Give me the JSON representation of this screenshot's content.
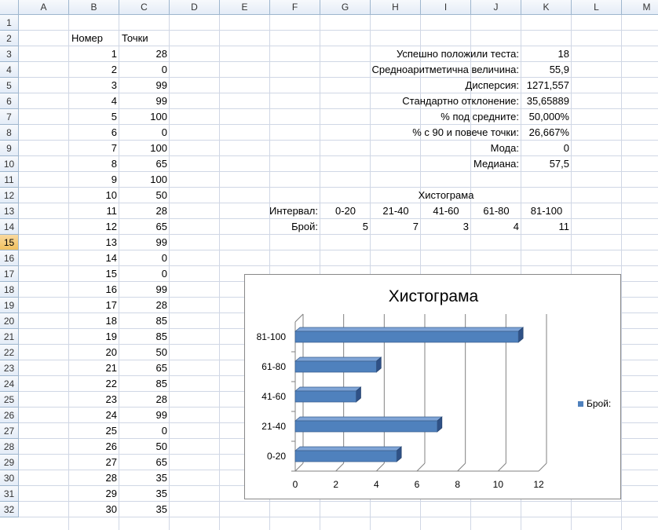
{
  "columns": [
    "A",
    "B",
    "C",
    "D",
    "E",
    "F",
    "G",
    "H",
    "I",
    "J",
    "K",
    "L",
    "M"
  ],
  "rows": [
    "1",
    "2",
    "3",
    "4",
    "5",
    "6",
    "7",
    "8",
    "9",
    "10",
    "11",
    "12",
    "13",
    "14",
    "15",
    "16",
    "17",
    "18",
    "19",
    "20",
    "21",
    "22",
    "23",
    "24",
    "25",
    "26",
    "27",
    "28",
    "29",
    "30",
    "31",
    "32"
  ],
  "selected_row": "15",
  "table": {
    "header_num": "Номер",
    "header_points": "Точки",
    "rows": [
      [
        "1",
        "28"
      ],
      [
        "2",
        "0"
      ],
      [
        "3",
        "99"
      ],
      [
        "4",
        "99"
      ],
      [
        "5",
        "100"
      ],
      [
        "6",
        "0"
      ],
      [
        "7",
        "100"
      ],
      [
        "8",
        "65"
      ],
      [
        "9",
        "100"
      ],
      [
        "10",
        "50"
      ],
      [
        "11",
        "28"
      ],
      [
        "12",
        "65"
      ],
      [
        "13",
        "99"
      ],
      [
        "14",
        "0"
      ],
      [
        "15",
        "0"
      ],
      [
        "16",
        "99"
      ],
      [
        "17",
        "28"
      ],
      [
        "18",
        "85"
      ],
      [
        "19",
        "85"
      ],
      [
        "20",
        "50"
      ],
      [
        "21",
        "65"
      ],
      [
        "22",
        "85"
      ],
      [
        "23",
        "28"
      ],
      [
        "24",
        "99"
      ],
      [
        "25",
        "0"
      ],
      [
        "26",
        "50"
      ],
      [
        "27",
        "65"
      ],
      [
        "28",
        "35"
      ],
      [
        "29",
        "35"
      ],
      [
        "30",
        "35"
      ]
    ]
  },
  "stats": [
    {
      "label": "Успешно положили теста:",
      "value": "18"
    },
    {
      "label": "Средноаритметична величина:",
      "value": "55,9"
    },
    {
      "label": "Дисперсия:",
      "value": "1271,557"
    },
    {
      "label": "Стандартно отклонение:",
      "value": "35,65889"
    },
    {
      "label": "% под средните:",
      "value": "50,000%"
    },
    {
      "label": "% с 90 и повече точки:",
      "value": "26,667%"
    },
    {
      "label": "Мода:",
      "value": "0"
    },
    {
      "label": "Медиана:",
      "value": "57,5"
    }
  ],
  "histogram_table": {
    "title": "Хистограма",
    "interval_label": "Интервал:",
    "count_label": "Брой:",
    "intervals": [
      "0-20",
      "21-40",
      "41-60",
      "61-80",
      "81-100"
    ],
    "counts": [
      "5",
      "7",
      "3",
      "4",
      "11"
    ]
  },
  "chart_data": {
    "type": "bar",
    "orientation": "horizontal",
    "title": "Хистограма",
    "categories": [
      "0-20",
      "21-40",
      "41-60",
      "61-80",
      "81-100"
    ],
    "series": [
      {
        "name": "Брой:",
        "values": [
          5,
          7,
          3,
          4,
          11
        ]
      }
    ],
    "xlim": [
      0,
      12
    ],
    "xticks": [
      "0",
      "2",
      "4",
      "6",
      "8",
      "10",
      "12"
    ],
    "grid": true,
    "legend": "right",
    "bar_color": "#4f81bd"
  }
}
